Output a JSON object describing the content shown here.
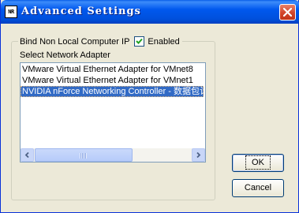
{
  "window": {
    "app_icon_text": "NR",
    "title": "Advanced Settings"
  },
  "group": {
    "legend_label": "Bind Non Local Computer IP",
    "checkbox_label": "Enabled",
    "checkbox_checked": true,
    "select_label": "Select Network Adapter"
  },
  "adapters": {
    "items": [
      "VMware Virtual Ethernet Adapter for VMnet8",
      "VMware Virtual Ethernet Adapter for VMnet1",
      "NVIDIA nForce Networking Controller - 数据包计"
    ],
    "selected_index": 2
  },
  "buttons": {
    "ok_label": "OK",
    "cancel_label": "Cancel"
  },
  "colors": {
    "titlebar": "#0058ee",
    "selection": "#316ac5",
    "close": "#d2452a"
  },
  "icons": [
    "app-icon",
    "close-icon",
    "checkmark-icon",
    "scroll-left-arrow-icon",
    "scroll-right-arrow-icon",
    "scroll-grip-icon"
  ]
}
